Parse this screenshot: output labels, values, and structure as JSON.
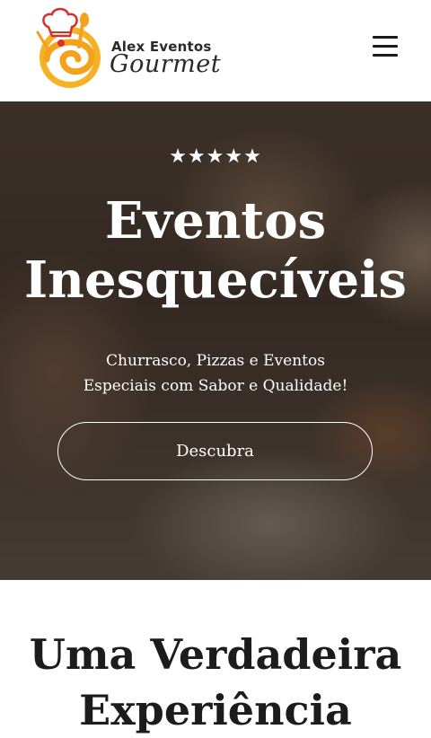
{
  "header": {
    "logo": {
      "line1": "Alex Eventos",
      "line2": "Gourmet",
      "icon": "chef-hat-logo-icon"
    },
    "menu_icon": "hamburger-menu-icon"
  },
  "hero": {
    "rating": "★★★★★",
    "title_line1": "Eventos",
    "title_line2": "Inesquecíveis",
    "subtitle_line1": "Churrasco, Pizzas e Eventos",
    "subtitle_line2": "Especiais com Sabor e Qualidade!",
    "cta_label": "Descubra"
  },
  "section": {
    "title_line1": "Uma Verdadeira",
    "title_line2": "Experiência"
  },
  "colors": {
    "logo_orange": "#f2a21b",
    "logo_red": "#d8312a",
    "text_dark": "#1c1c1c",
    "hero_text": "#ffffff"
  }
}
